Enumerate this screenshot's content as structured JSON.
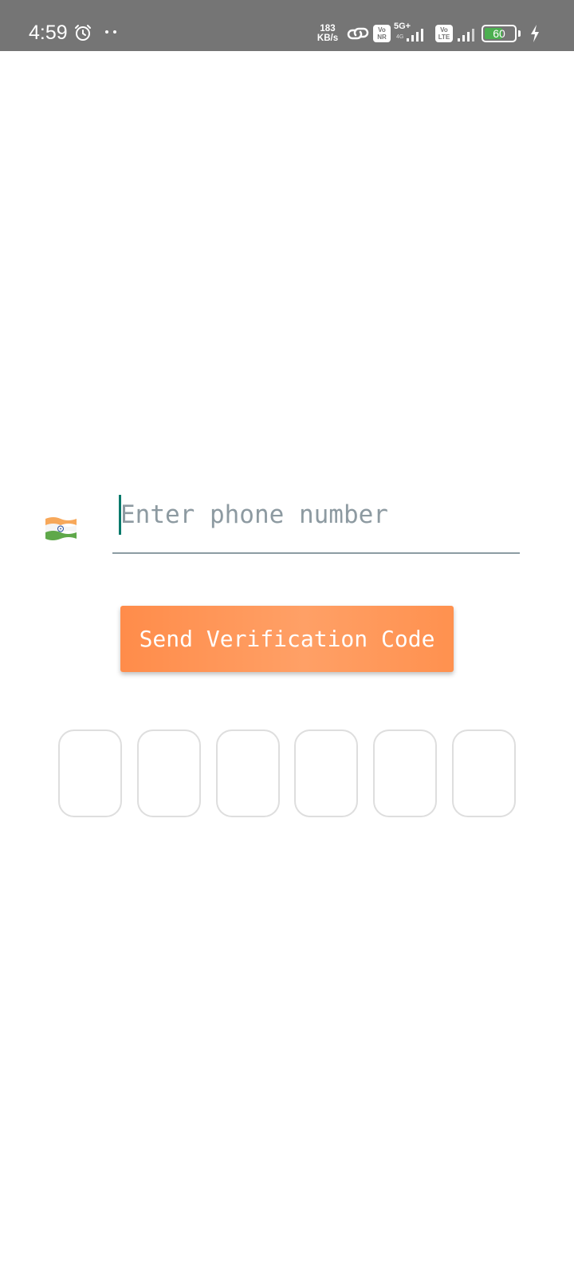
{
  "status_bar": {
    "time": "4:59",
    "network_speed_value": "183",
    "network_speed_unit": "KB/s",
    "sim1_badge_top": "Vo",
    "sim1_badge_bottom": "NR",
    "sim1_network": "5G+",
    "sim1_network_sub": "4G",
    "sim2_badge_top": "Vo",
    "sim2_badge_bottom": "LTE",
    "battery_level": "60",
    "battery_fraction": 0.6,
    "charging": true,
    "icons": [
      "alarm-icon",
      "more-dots-icon",
      "link-icon",
      "signal-icon",
      "battery-icon",
      "charging-bolt-icon"
    ]
  },
  "phone": {
    "country_flag": "india-flag-icon",
    "placeholder": "Enter phone number",
    "value": ""
  },
  "send_button": {
    "label": "Send Verification Code",
    "color": "#FF914F"
  },
  "otp": {
    "boxes": [
      "",
      "",
      "",
      "",
      "",
      ""
    ]
  }
}
